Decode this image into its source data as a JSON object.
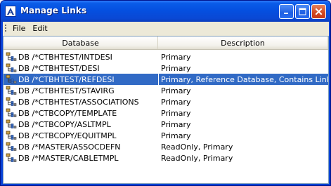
{
  "window": {
    "title": "Manage Links",
    "controls": {
      "minimize": "minimize",
      "maximize": "maximize",
      "close": "close"
    }
  },
  "menubar": {
    "items": [
      {
        "label": "File"
      },
      {
        "label": "Edit"
      }
    ]
  },
  "table": {
    "columns": [
      {
        "label": "Database"
      },
      {
        "label": "Description"
      }
    ],
    "selected_row": 2,
    "rows": [
      {
        "database": "DB /*CTBHTEST/INTDESI",
        "description": "Primary"
      },
      {
        "database": "DB /*CTBHTEST/DESI",
        "description": "Primary"
      },
      {
        "database": "DB /*CTBHTEST/REFDESI",
        "description": "Primary, Reference Database, Contains Links"
      },
      {
        "database": "DB /*CTBHTEST/STAVIRG",
        "description": "Primary"
      },
      {
        "database": "DB /*CTBHTEST/ASSOCIATIONS",
        "description": "Primary"
      },
      {
        "database": "DB /*CTBCOPY/TEMPLATE",
        "description": "Primary"
      },
      {
        "database": "DB /*CTBCOPY/ASLTMPL",
        "description": "Primary"
      },
      {
        "database": "DB /*CTBCOPY/EQUITMPL",
        "description": "Primary"
      },
      {
        "database": "DB /*MASTER/ASSOCDEFN",
        "description": "ReadOnly, Primary"
      },
      {
        "database": "DB /*MASTER/CABLETMPL",
        "description": "ReadOnly, Primary"
      }
    ]
  },
  "colors": {
    "titlebar": "#0a5ce8",
    "selection": "#316ac5",
    "client_bg": "#ece9d8"
  },
  "icons": {
    "app": "app-logo-icon",
    "row": "database-tree-icon"
  }
}
